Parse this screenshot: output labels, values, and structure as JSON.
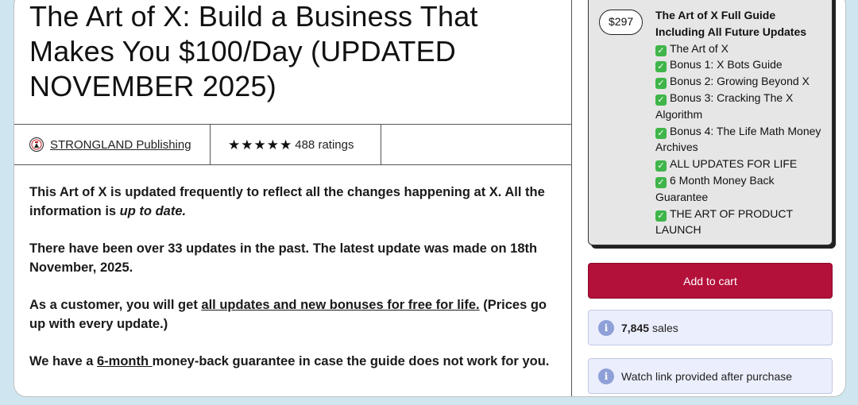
{
  "product": {
    "title": "The Art of X: Build a Business That Makes You $100/Day (UPDATED NOVEMBER 2025)"
  },
  "author": {
    "name": "STRONGLAND Publishing",
    "logo_icon": "author-logo-icon"
  },
  "rating": {
    "stars": 5,
    "text": "488 ratings"
  },
  "description": {
    "p1_text": "This Art of X is updated frequently to reflect all the changes happening at X. All the information is ",
    "p1_em": "up to date.",
    "p2": "There have been over 33 updates in the past. The latest update was made on 18th November, 2025.",
    "p3_before": "As a customer, you will get ",
    "p3_link": "all updates and new bonuses for free for life.",
    "p3_after": " (Prices go up with every update.)",
    "p4_before": "We have a ",
    "p4_link": "6-month ",
    "p4_after": "money-back guarantee in case the guide does not work for you."
  },
  "offer": {
    "price": "$297",
    "title": "The Art of X Full Guide Including All Future Updates",
    "items": [
      "The Art of X",
      "Bonus 1: X Bots Guide",
      "Bonus 2: Growing Beyond X",
      "Bonus 3: Cracking The X Algorithm",
      "Bonus 4: The Life Math Money Archives",
      "ALL UPDATES FOR LIFE",
      "6 Month Money Back Guarantee",
      "THE ART OF PRODUCT LAUNCH"
    ],
    "check_icon": "check-mark-icon"
  },
  "cart": {
    "label": "Add to cart"
  },
  "info": {
    "sales_count": "7,845",
    "sales_label": "sales",
    "link_notice": "Watch link provided after purchase",
    "icon_glyph": "i"
  },
  "colors": {
    "cart_button": "#b3103a",
    "info_box": "#ebeefc",
    "offer_box": "#e6e6e6",
    "background": "#cfe6f0",
    "check": "#3fb54a"
  }
}
